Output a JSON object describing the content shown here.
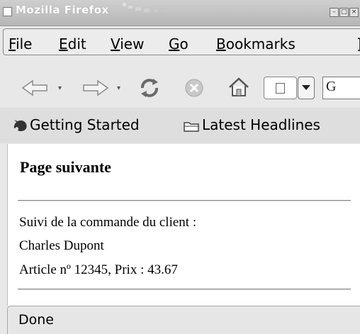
{
  "window": {
    "title": "Mozilla Firefox",
    "controls": [
      "minimize",
      "maximize",
      "close"
    ]
  },
  "menubar": {
    "items": [
      {
        "label": "File",
        "mnemonic": "F",
        "rest": "ile"
      },
      {
        "label": "Edit",
        "mnemonic": "E",
        "rest": "dit"
      },
      {
        "label": "View",
        "mnemonic": "V",
        "rest": "iew"
      },
      {
        "label": "Go",
        "mnemonic": "G",
        "rest": "o"
      },
      {
        "label": "Bookmarks",
        "mnemonic": "B",
        "rest": "ookmarks"
      }
    ]
  },
  "navbar": {
    "icons": [
      "back-icon",
      "forward-icon",
      "reload-icon",
      "stop-icon",
      "home-icon",
      "page-icon",
      "search-engine-icon"
    ],
    "search_engine_letter": "G"
  },
  "bookmarks": {
    "items": [
      {
        "label": "Getting Started",
        "icon": "firefox-icon"
      },
      {
        "label": "Latest Headlines",
        "icon": "rss-folder-icon"
      }
    ]
  },
  "page": {
    "heading": "Page suivante",
    "lines": [
      "Suivi de la commande du client :",
      "Charles Dupont",
      "Article nº 12345, Prix : 43.67"
    ]
  },
  "status": {
    "text": "Done"
  }
}
